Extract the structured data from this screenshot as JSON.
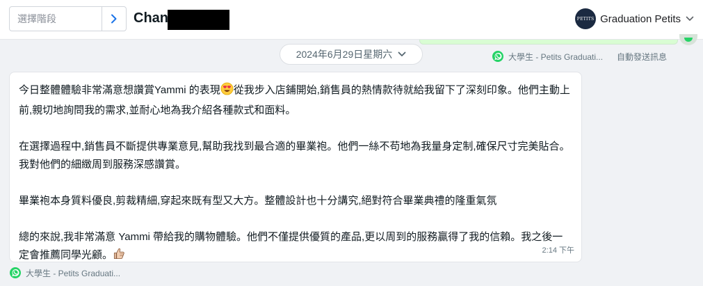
{
  "header": {
    "stage_placeholder": "選擇階段",
    "contact_name": "Chan",
    "account_name": "Graduation Petits",
    "account_logo_text": "PETITS"
  },
  "date_separator": {
    "label": "2024年6月29日星期六"
  },
  "top_meta": {
    "sender": "大學生 - Petits Graduati...",
    "auto_label": "自動發送訊息"
  },
  "message": {
    "paragraphs": [
      "今日整體體驗非常滿意想讚賞Yammi 的表現",
      "從我步入店鋪開始,銷售員的熱情款待就給我留下了深刻印象。他們主動上前,親切地詢問我的需求,並耐心地為我介紹各種款式和面料。",
      "在選擇過程中,銷售員不斷提供專業意見,幫助我找到最合適的畢業袍。他們一絲不苟地為我量身定制,確保尺寸完美貼合。我對他們的細緻周到服務深感讚賞。",
      "畢業袍本身質料優良,剪裁精細,穿起來既有型又大方。整體設計也十分講究,絕對符合畢業典禮的隆重氣氛",
      "總的來說,我非常滿意 Yammi 帶給我的購物體驗。他們不僅提供優質的產品,更以周到的服務贏得了我的信賴。我之後一定會推薦同學光顧。"
    ],
    "time": "2:14 下午"
  },
  "bottom_meta": {
    "sender": "大學生 - Petits Graduati..."
  },
  "colors": {
    "background": "#f0f2f5",
    "whatsapp_green": "#25d366",
    "outgoing_bubble": "#d9fdd3",
    "accent_blue": "#1a73e8"
  },
  "icons": [
    "chevron-right-icon",
    "chevron-down-icon",
    "whatsapp-icon",
    "heart-eyes-emoji",
    "thumbs-up-emoji"
  ]
}
